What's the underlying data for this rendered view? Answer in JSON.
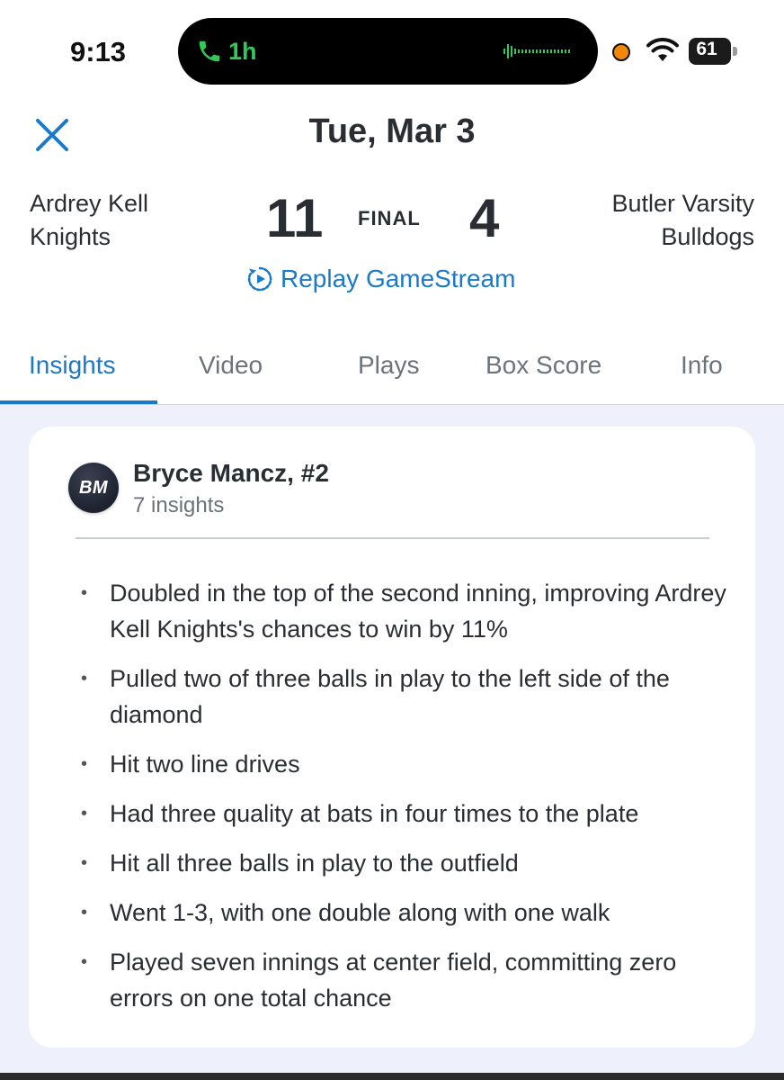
{
  "status_bar": {
    "time": "9:13",
    "call_duration": "1h",
    "battery": "61",
    "colors": {
      "call_green": "#34c759",
      "recording_dot": "#f2880b"
    }
  },
  "header": {
    "date": "Tue, Mar 3",
    "home_team": {
      "line1": "Ardrey Kell",
      "line2": "Knights",
      "score": "11"
    },
    "away_team": {
      "line1": "Butler Varsity",
      "line2": "Bulldogs",
      "score": "4"
    },
    "status": "FINAL",
    "replay_label": "Replay GameStream"
  },
  "tabs": [
    {
      "label": "Insights",
      "active": true
    },
    {
      "label": "Video",
      "active": false
    },
    {
      "label": "Plays",
      "active": false
    },
    {
      "label": "Box Score",
      "active": false
    },
    {
      "label": "Info",
      "active": false
    }
  ],
  "player_card": {
    "initials": "BM",
    "name": "Bryce Mancz, #2",
    "insight_count": "7 insights",
    "bullet": "•",
    "insights": [
      "Doubled in the top of the second inning, improving Ardrey Kell Knights's chances to win by 11%",
      "Pulled two of three balls in play to the left side of the diamond",
      "Hit two line drives",
      "Had three quality at bats in four times to the plate",
      "Hit all three balls in play to the outfield",
      "Went 1-3, with one double along with one walk",
      "Played seven innings at center field, committing zero errors on one total chance"
    ]
  },
  "theme": {
    "accent": "#1a7ac9",
    "background": "#eef0fb",
    "card": "#ffffff"
  }
}
